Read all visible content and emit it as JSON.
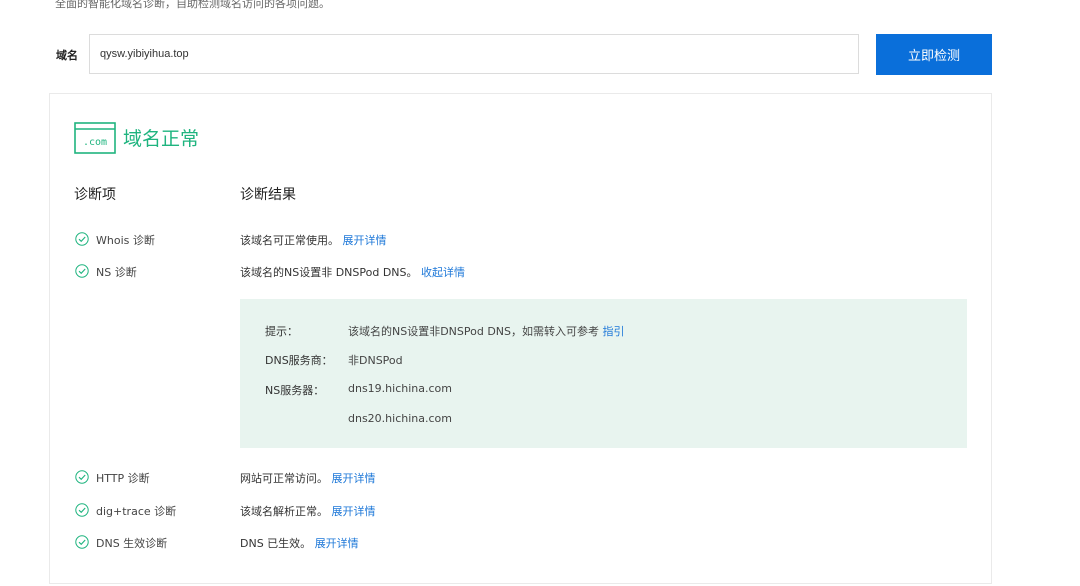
{
  "intro": {
    "text": "全面的智能化域名诊断，自助检测域名访问的各项问题。"
  },
  "search": {
    "label": "域名",
    "value": "qysw.yibiyihua.top",
    "button_label": "立即检测"
  },
  "result": {
    "icon_text": ".com",
    "status_title": "域名正常",
    "status_color": "#1fb47f",
    "col_item": "诊断项",
    "col_result": "诊断结果",
    "rows": [
      {
        "name": "Whois 诊断",
        "text": "该域名可正常使用。",
        "link": "展开详情"
      },
      {
        "name": "NS 诊断",
        "text": "该域名的NS设置非 DNSPod DNS。",
        "link": "收起详情"
      },
      {
        "name": "HTTP 诊断",
        "text": "网站可正常访问。",
        "link": "展开详情"
      },
      {
        "name": "dig+trace 诊断",
        "text": "该域名解析正常。",
        "link": "展开详情"
      },
      {
        "name": "DNS 生效诊断",
        "text": "DNS 已生效。",
        "link": "展开详情"
      }
    ],
    "ns_details": {
      "tip_label": "提示：",
      "tip_text": "该域名的NS设置非DNSPod DNS，如需转入可参考",
      "tip_link": "指引",
      "provider_label": "DNS服务商：",
      "provider_value": "非DNSPod",
      "ns_label": "NS服务器：",
      "ns_servers": [
        "dns19.hichina.com",
        "dns20.hichina.com"
      ]
    }
  },
  "colors": {
    "accent_blue": "#0a6fda",
    "link_blue": "#1e78d8",
    "success_green": "#1fb47f",
    "panel_bg": "#e8f4ef"
  }
}
